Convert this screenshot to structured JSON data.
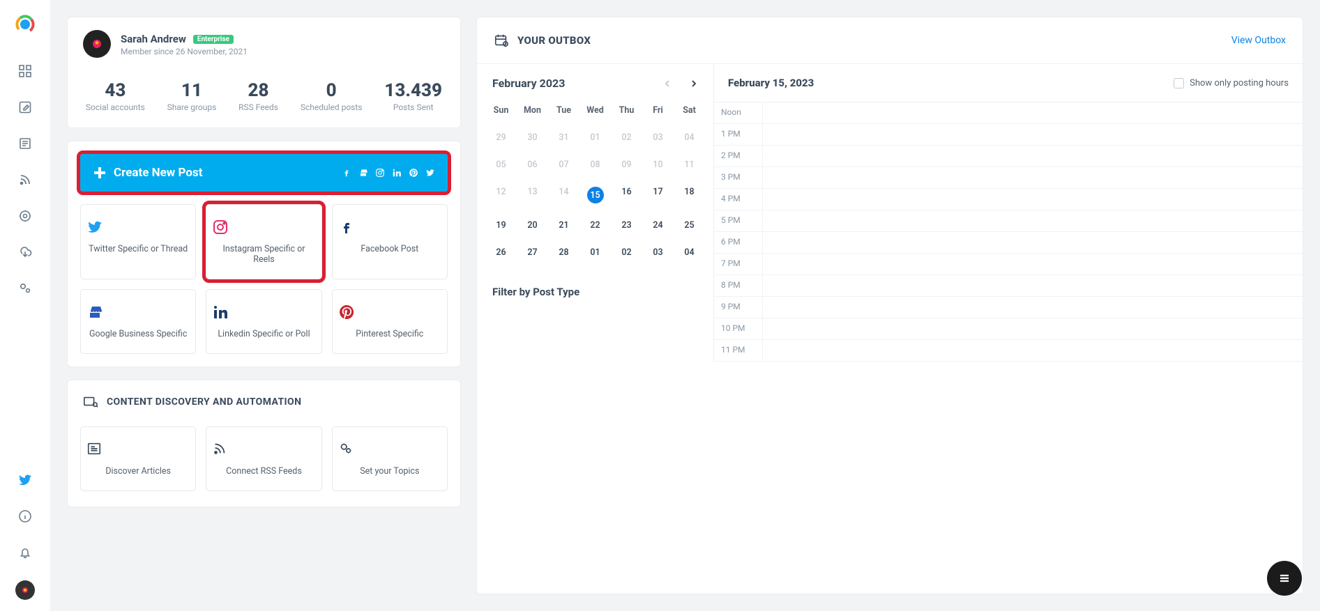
{
  "profile": {
    "name": "Sarah Andrew",
    "badge": "Enterprise",
    "since": "Member since 26 November, 2021"
  },
  "stats": [
    {
      "num": "43",
      "lbl": "Social accounts"
    },
    {
      "num": "11",
      "lbl": "Share groups"
    },
    {
      "num": "28",
      "lbl": "RSS Feeds"
    },
    {
      "num": "0",
      "lbl": "Scheduled posts"
    },
    {
      "num": "13.439",
      "lbl": "Posts Sent"
    }
  ],
  "create": {
    "label": "Create New Post"
  },
  "tiles": [
    {
      "label": "Twitter Specific or Thread",
      "icon": "twitter"
    },
    {
      "label": "Instagram Specific or Reels",
      "icon": "instagram"
    },
    {
      "label": "Facebook Post",
      "icon": "facebook"
    },
    {
      "label": "Google Business Specific",
      "icon": "store"
    },
    {
      "label": "Linkedin Specific or Poll",
      "icon": "linkedin"
    },
    {
      "label": "Pinterest Specific",
      "icon": "pinterest"
    }
  ],
  "discovery": {
    "title": "CONTENT DISCOVERY AND AUTOMATION",
    "tiles": [
      {
        "label": "Discover Articles"
      },
      {
        "label": "Connect RSS Feeds"
      },
      {
        "label": "Set your Topics"
      }
    ]
  },
  "outbox": {
    "title": "YOUR OUTBOX",
    "view_link": "View Outbox",
    "month": "February 2023",
    "selected_date": "February 15, 2023",
    "show_only_label": "Show only posting hours",
    "dow": [
      "Sun",
      "Mon",
      "Tue",
      "Wed",
      "Thu",
      "Fri",
      "Sat"
    ],
    "weeks": [
      [
        {
          "d": "29",
          "dim": true
        },
        {
          "d": "30",
          "dim": true
        },
        {
          "d": "31",
          "dim": true
        },
        {
          "d": "01",
          "dim": true
        },
        {
          "d": "02",
          "dim": true
        },
        {
          "d": "03",
          "dim": true
        },
        {
          "d": "04",
          "dim": true
        }
      ],
      [
        {
          "d": "05",
          "dim": true
        },
        {
          "d": "06",
          "dim": true
        },
        {
          "d": "07",
          "dim": true
        },
        {
          "d": "08",
          "dim": true
        },
        {
          "d": "09",
          "dim": true
        },
        {
          "d": "10",
          "dim": true
        },
        {
          "d": "11",
          "dim": true
        }
      ],
      [
        {
          "d": "12",
          "dim": true
        },
        {
          "d": "13",
          "dim": true
        },
        {
          "d": "14",
          "dim": true
        },
        {
          "d": "15",
          "sel": true
        },
        {
          "d": "16"
        },
        {
          "d": "17"
        },
        {
          "d": "18"
        }
      ],
      [
        {
          "d": "19"
        },
        {
          "d": "20"
        },
        {
          "d": "21"
        },
        {
          "d": "22"
        },
        {
          "d": "23"
        },
        {
          "d": "24"
        },
        {
          "d": "25"
        }
      ],
      [
        {
          "d": "26"
        },
        {
          "d": "27"
        },
        {
          "d": "28"
        },
        {
          "d": "01"
        },
        {
          "d": "02"
        },
        {
          "d": "03"
        },
        {
          "d": "04"
        }
      ]
    ],
    "filter_title": "Filter by Post Type",
    "hours": [
      "Noon",
      "1 PM",
      "2 PM",
      "3 PM",
      "4 PM",
      "5 PM",
      "6 PM",
      "7 PM",
      "8 PM",
      "9 PM",
      "10 PM",
      "11 PM"
    ]
  },
  "colors": {
    "accent": "#00acee",
    "primary": "#0b82e6",
    "highlight_red": "#d91f33"
  }
}
